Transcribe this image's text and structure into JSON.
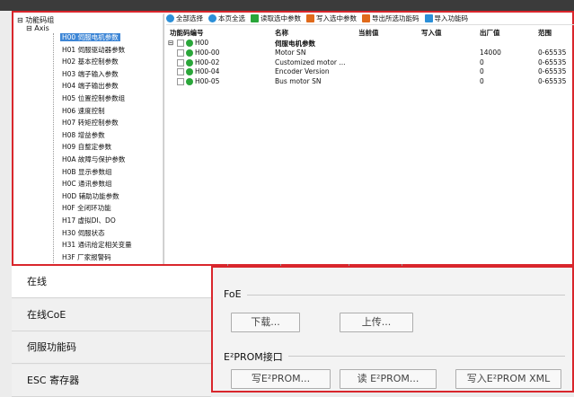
{
  "tree": {
    "root": "功能码组",
    "axis": "Axis",
    "items": [
      "H00 伺服电机参数",
      "H01 伺服驱动器参数",
      "H02 基本控制参数",
      "H03 端子输入参数",
      "H04 端子输出参数",
      "H05 位置控制参数组",
      "H06 速度控制",
      "H07 转矩控制参数",
      "H08 增益参数",
      "H09 自整定参数",
      "H0A 故障与保护参数",
      "H0B 显示参数组",
      "H0C 通讯参数组",
      "H0D 辅助功能参数",
      "H0F 全闭环功能",
      "H17 虚拟DI、DO",
      "H30 伺服状态",
      "H31 通讯给定相关变量",
      "H3F 厂家报警码"
    ],
    "selected_index": 0
  },
  "toolbar": {
    "items": [
      {
        "label": "全部选择",
        "icon": "select-all-icon",
        "color": "#2b8fd8"
      },
      {
        "label": "本页全选",
        "icon": "page-select-icon",
        "color": "#2b8fd8"
      },
      {
        "label": "读取选中参数",
        "icon": "read-icon",
        "color": "#2aa63a"
      },
      {
        "label": "写入选中参数",
        "icon": "write-icon",
        "color": "#e06a1b"
      },
      {
        "label": "导出所选功能码",
        "icon": "export-icon",
        "color": "#e06a1b"
      },
      {
        "label": "导入功能码",
        "icon": "import-icon",
        "color": "#2b8fd8"
      }
    ]
  },
  "grid": {
    "headers": [
      "功能码编号",
      "名称",
      "当前值",
      "写入值",
      "出厂值",
      "范围"
    ],
    "group_row": {
      "code": "H00",
      "name": "伺服电机参数"
    },
    "rows": [
      {
        "code": "H00-00",
        "name": "Motor SN",
        "current": "",
        "write": "",
        "factory": "14000",
        "range": "0-65535"
      },
      {
        "code": "H00-02",
        "name": "Customized motor ...",
        "current": "",
        "write": "",
        "factory": "0",
        "range": "0-65535"
      },
      {
        "code": "H00-04",
        "name": "Encoder Version",
        "current": "",
        "write": "",
        "factory": "0",
        "range": "0-65535"
      },
      {
        "code": "H00-05",
        "name": "Bus motor SN",
        "current": "",
        "write": "",
        "factory": "0",
        "range": "0-65535"
      }
    ]
  },
  "nav": {
    "items": [
      "在线",
      "在线CoE",
      "伺服功能码",
      "ESC 寄存器"
    ],
    "active_index": 0
  },
  "foe": {
    "label": "FoE",
    "download": "下载...",
    "upload": "上传..."
  },
  "eeprom": {
    "label": "E²PROM接口",
    "write": "写E²PROM...",
    "read": "读 E²PROM...",
    "write_xml": "写入E²PROM XML"
  }
}
